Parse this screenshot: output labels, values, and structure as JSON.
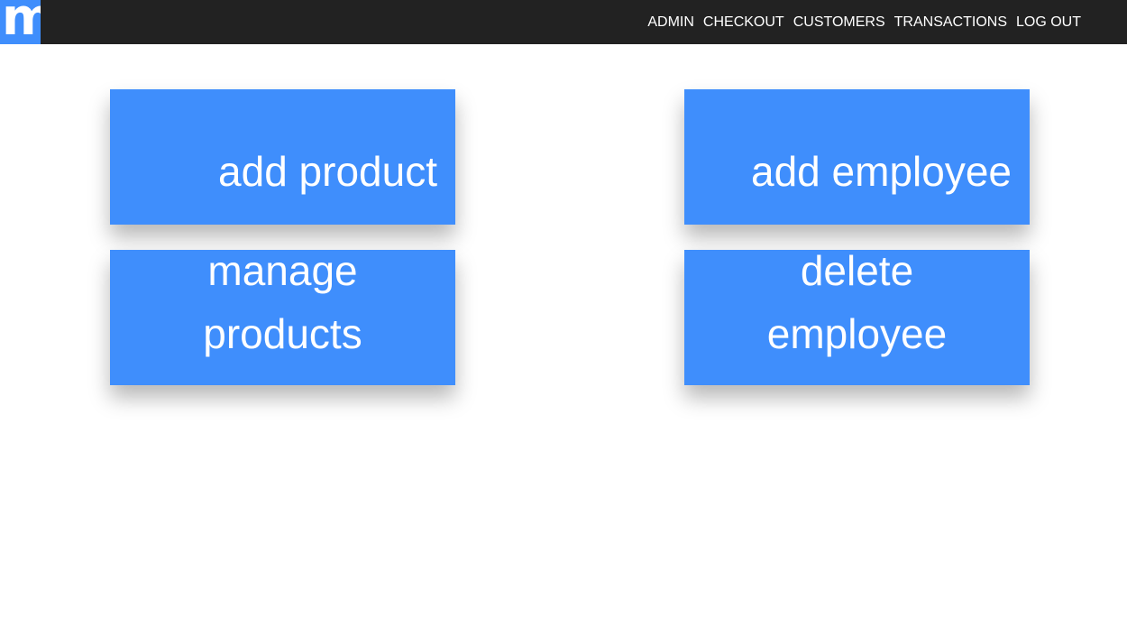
{
  "header": {
    "logo_letter": "m",
    "nav": {
      "admin": "ADMIN",
      "checkout": "CHECKOUT",
      "customers": "CUSTOMERS",
      "transactions": "TRANSACTIONS",
      "logout": "LOG OUT"
    },
    "colors": {
      "bar": "#222222",
      "brand": "#3f8efc"
    }
  },
  "tiles": {
    "add_product": "add product",
    "add_employee": "add employee",
    "manage_products": [
      "manage",
      "products"
    ],
    "delete_employee": [
      "delete",
      "employee"
    ]
  }
}
